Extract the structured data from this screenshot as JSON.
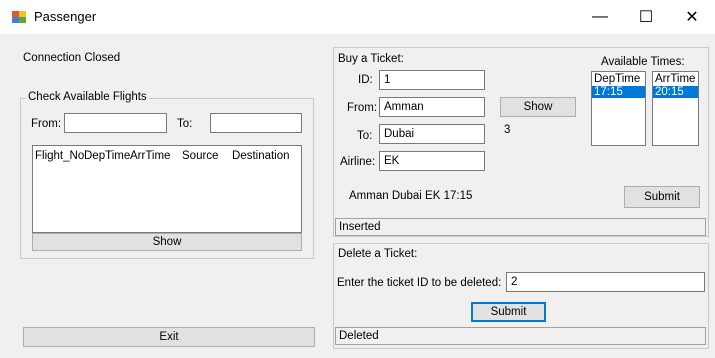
{
  "window": {
    "title": "Passenger",
    "minimize": "—",
    "maximize": "☐",
    "close": "✕"
  },
  "connection_status": "Connection Closed",
  "check_flights": {
    "title": "Check Available Flights",
    "from_label": "From:",
    "from_value": "",
    "to_label": "To:",
    "to_value": "",
    "columns": [
      "Flight_No",
      "DepTime",
      "ArrTime",
      "Source",
      "Destination"
    ],
    "show_label": "Show"
  },
  "exit_label": "Exit",
  "buy_ticket": {
    "title": "Buy a Ticket:",
    "id_label": "ID:",
    "id_value": "1",
    "from_label": "From:",
    "from_value": "Amman",
    "to_label": "To:",
    "to_value": "Dubai",
    "airline_label": "Airline:",
    "airline_value": "EK",
    "show_label": "Show",
    "count_value": "3",
    "summary": "Amman Dubai EK 17:15",
    "submit_label": "Submit",
    "available_times_title": "Available Times:",
    "dep_header": "DepTime",
    "dep_selected": "17:15",
    "arr_header": "ArrTime",
    "arr_selected": "20:15",
    "status": "Inserted"
  },
  "delete_ticket": {
    "title": "Delete a Ticket:",
    "prompt": "Enter the ticket ID to be deleted:",
    "id_value": "2",
    "submit_label": "Submit",
    "status": "Deleted"
  }
}
